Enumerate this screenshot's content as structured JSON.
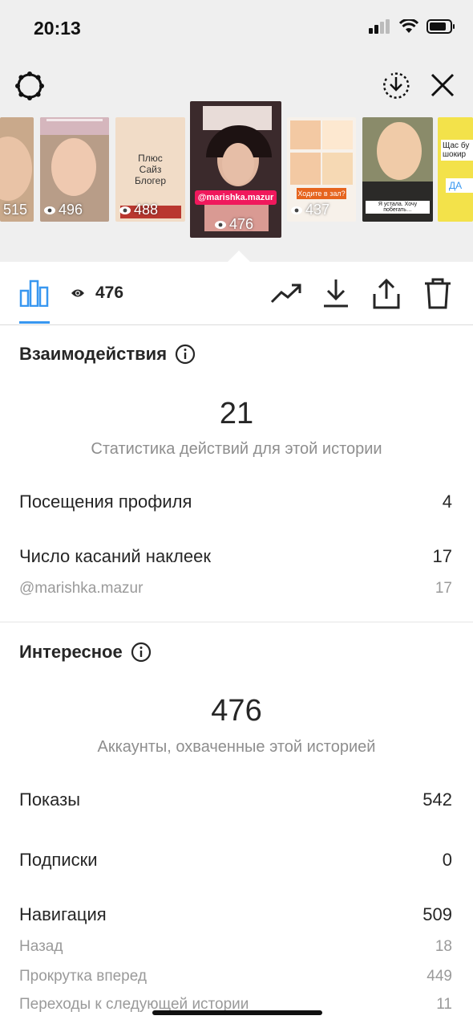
{
  "status_bar": {
    "time": "20:13"
  },
  "stories": [
    {
      "views": "515"
    },
    {
      "views": "496"
    },
    {
      "views": "488",
      "text": "Плюс Сайз Блогер"
    },
    {
      "views": "476",
      "tag": "@marishka.mazur",
      "selected": true
    },
    {
      "views": "437",
      "text": "Ходите в зал?"
    },
    {
      "views": "",
      "text": "Я устала. Хочу побегать…"
    },
    {
      "views": "",
      "text": "Щас бу шокир",
      "choice": "ДА"
    }
  ],
  "toolbar": {
    "views": "476"
  },
  "interactions": {
    "title": "Взаимодействия",
    "total": "21",
    "subtitle": "Статистика действий для этой истории",
    "rows": [
      {
        "label": "Посещения профиля",
        "value": "4"
      },
      {
        "label": "Число касаний наклеек",
        "value": "17"
      }
    ],
    "sub_rows": [
      {
        "label": "@marishka.mazur",
        "value": "17"
      }
    ]
  },
  "discovery": {
    "title": "Интересное",
    "total": "476",
    "subtitle": "Аккаунты, охваченные этой историей",
    "rows": [
      {
        "label": "Показы",
        "value": "542"
      },
      {
        "label": "Подписки",
        "value": "0"
      },
      {
        "label": "Навигация",
        "value": "509"
      }
    ],
    "sub_rows": [
      {
        "label": "Назад",
        "value": "18"
      },
      {
        "label": "Прокрутка вперед",
        "value": "449"
      },
      {
        "label": "Переходы к следующей истории",
        "value": "11"
      }
    ]
  },
  "colors": {
    "accent": "#3897f0",
    "text": "#262626",
    "muted": "#8e8e8e",
    "story_pink": "#f0185c"
  }
}
